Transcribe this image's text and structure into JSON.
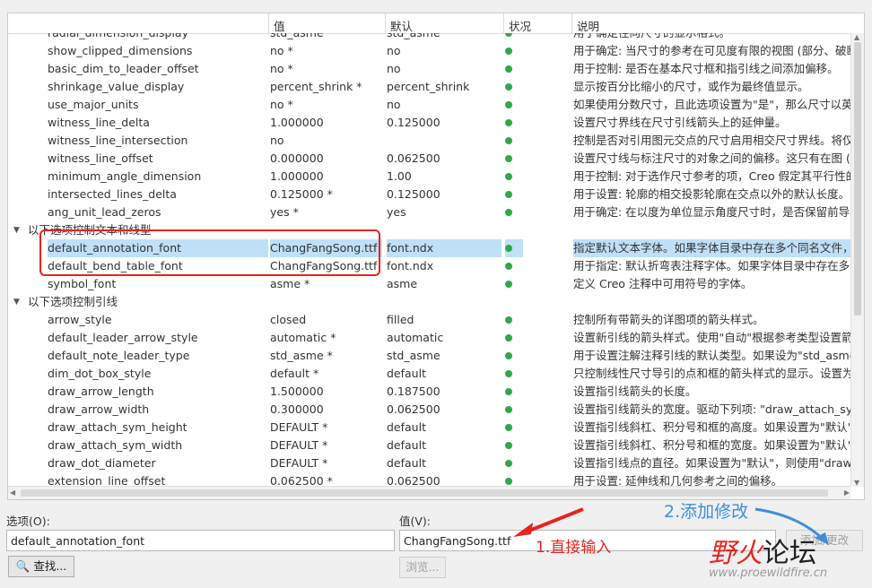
{
  "columns": {
    "name": "",
    "value": "值",
    "default": "默认",
    "status": "状况",
    "description": "说明"
  },
  "rows": [
    {
      "kind": "item",
      "name": "radial_dimension_display",
      "value": "std_asme",
      "default": "std_asme",
      "status": true,
      "description": "用于确定径向尺寸的显示格式。"
    },
    {
      "kind": "item",
      "name": "show_clipped_dimensions",
      "value": "no *",
      "default": "no",
      "status": true,
      "description": "用于确定: 当尺寸的参考在可见度有限的视图 (部分、破断、"
    },
    {
      "kind": "item",
      "name": "basic_dim_to_leader_offset",
      "value": "no *",
      "default": "no",
      "status": true,
      "description": "用于控制: 是否在基本尺寸框和指引线之间添加偏移。"
    },
    {
      "kind": "item",
      "name": "shrinkage_value_display",
      "value": "percent_shrink *",
      "default": "percent_shrink",
      "status": true,
      "description": "显示按百分比缩小的尺寸，或作为最终值显示。"
    },
    {
      "kind": "item",
      "name": "use_major_units",
      "value": "no *",
      "default": "no",
      "status": true,
      "description": "如果使用分数尺寸，且此选项设置为\"是\"，那么尺寸以英尺和"
    },
    {
      "kind": "item",
      "name": "witness_line_delta",
      "value": "1.000000",
      "default": "0.125000",
      "status": true,
      "description": "设置尺寸界线在尺寸引线箭头上的延伸量。"
    },
    {
      "kind": "item",
      "name": "witness_line_intersection",
      "value": "no",
      "default": "",
      "status": true,
      "description": "控制是否对引用图元交点的尺寸启用相交尺寸界线。将仅影"
    },
    {
      "kind": "item",
      "name": "witness_line_offset",
      "value": "0.000000",
      "default": "0.062500",
      "status": true,
      "description": "设置尺寸线与标注尺寸的对象之间的偏移。这只有在图 (X"
    },
    {
      "kind": "item",
      "name": "minimum_angle_dimension",
      "value": "1.000000",
      "default": "1.00",
      "status": true,
      "description": "用于控制: 对于选作尺寸参考的项，Creo 假定其平行性的最"
    },
    {
      "kind": "item",
      "name": "intersected_lines_delta",
      "value": "0.125000 *",
      "default": "0.125000",
      "status": true,
      "description": "用于设置: 轮廓的相交投影轮廓在交点以外的默认长度。"
    },
    {
      "kind": "item",
      "name": "ang_unit_lead_zeros",
      "value": "yes *",
      "default": "yes",
      "status": true,
      "description": "用于确定: 在以度为单位显示角度尺寸时，是否保留前导零。"
    },
    {
      "kind": "group",
      "name": "以下选项控制文本和线型"
    },
    {
      "kind": "item",
      "name": "default_annotation_font",
      "value": "ChangFangSong.ttf",
      "default": "font.ndx",
      "status": true,
      "description": "指定默认文本字体。如果字体目录中存在多个同名文件，则",
      "highlight": true
    },
    {
      "kind": "item",
      "name": "default_bend_table_font",
      "value": "ChangFangSong.ttf",
      "default": "font.ndx",
      "status": true,
      "description": "用于指定: 默认折弯表注释字体。如果字体目录中存在多个同"
    },
    {
      "kind": "item",
      "name": "symbol_font",
      "value": "asme *",
      "default": "asme",
      "status": true,
      "description": "定义 Creo 注释中可用符号的字体。"
    },
    {
      "kind": "group",
      "name": "以下选项控制引线"
    },
    {
      "kind": "item",
      "name": "arrow_style",
      "value": "closed",
      "default": "filled",
      "status": true,
      "description": "控制所有带箭头的详图项的箭头样式。"
    },
    {
      "kind": "item",
      "name": "default_leader_arrow_style",
      "value": "automatic *",
      "default": "automatic",
      "status": true,
      "description": "设置新引线的箭头样式。使用\"自动\"根据参考类型设置箭头样"
    },
    {
      "kind": "item",
      "name": "default_note_leader_type",
      "value": "std_asme *",
      "default": "std_asme",
      "status": true,
      "description": "用于设置注解注释引线的默认类型。如果设为\"std_asme\"，则"
    },
    {
      "kind": "item",
      "name": "dim_dot_box_style",
      "value": "default *",
      "default": "default",
      "status": true,
      "description": "只控制线性尺寸导引的点和框的箭头样式的显示。设置为\"默"
    },
    {
      "kind": "item",
      "name": "draw_arrow_length",
      "value": "1.500000",
      "default": "0.187500",
      "status": true,
      "description": "设置指引线箭头的长度。"
    },
    {
      "kind": "item",
      "name": "draw_arrow_width",
      "value": "0.300000",
      "default": "0.062500",
      "status": true,
      "description": "设置指引线箭头的宽度。驱动下列项: \"draw_attach_sym_h"
    },
    {
      "kind": "item",
      "name": "draw_attach_sym_height",
      "value": "DEFAULT *",
      "default": "default",
      "status": true,
      "description": "设置指引线斜杠、积分号和框的高度。如果设置为\"默认\"，则"
    },
    {
      "kind": "item",
      "name": "draw_attach_sym_width",
      "value": "DEFAULT *",
      "default": "default",
      "status": true,
      "description": "设置指引线斜杠、积分号和框的宽度。如果设置为\"默认\"，则"
    },
    {
      "kind": "item",
      "name": "draw_dot_diameter",
      "value": "DEFAULT *",
      "default": "default",
      "status": true,
      "description": "设置指引线点的直径。如果设置为\"默认\"，则使用\"draw_ar"
    },
    {
      "kind": "item",
      "name": "extension_line_offset",
      "value": "0.062500 *",
      "default": "0.062500",
      "status": true,
      "description": "用于设置: 延伸线和几何参考之间的偏移。"
    }
  ],
  "bottom": {
    "option_label": "选项(O):",
    "option_value": "default_annotation_font",
    "value_label": "值(V):",
    "value_value": "ChangFangSong.ttf",
    "find_button": "查找...",
    "browse_button": "浏览...",
    "add_change_button": "添加/更改"
  },
  "annotations": {
    "step1": "1.直接输入",
    "step2": "2.添加修改"
  },
  "watermark": {
    "text_part1": "野火",
    "text_part2": "论坛",
    "url": "www.proewildfire.cn"
  },
  "colors": {
    "highlight": "#bfe0f7",
    "status_dot": "#2fa84a",
    "annotation_red": "#e8231e",
    "annotation_blue": "#3b8ee0"
  }
}
